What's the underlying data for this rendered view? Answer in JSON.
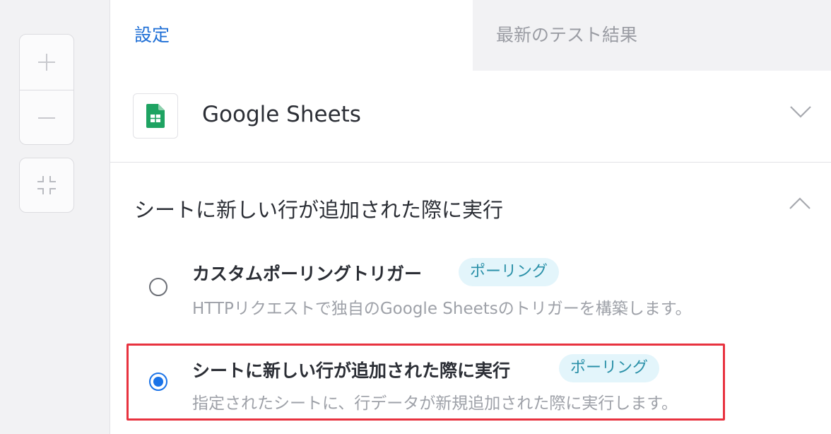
{
  "canvas_controls": {
    "zoom_in_icon": "plus-icon",
    "zoom_out_icon": "minus-icon",
    "fit_icon": "collapse-icon"
  },
  "tabs": {
    "settings_label": "設定",
    "results_label": "最新のテスト結果"
  },
  "app": {
    "name": "Google Sheets",
    "logo_icon": "google-sheets-icon",
    "brand_color": "#1ea362"
  },
  "trigger_section": {
    "title": "シートに新しい行が追加された際に実行",
    "options": [
      {
        "title": "カスタムポーリングトリガー",
        "badge": "ポーリング",
        "description": "HTTPリクエストで独自のGoogle Sheetsのトリガーを構築します。",
        "selected": false
      },
      {
        "title": "シートに新しい行が追加された際に実行",
        "badge": "ポーリング",
        "description": "指定されたシートに、行データが新規追加された際に実行します。",
        "selected": true
      }
    ]
  },
  "colors": {
    "accent": "#1a73e8",
    "highlight": "#e8323f",
    "badge_bg": "#e3f5fb",
    "badge_text": "#2a90a8"
  }
}
